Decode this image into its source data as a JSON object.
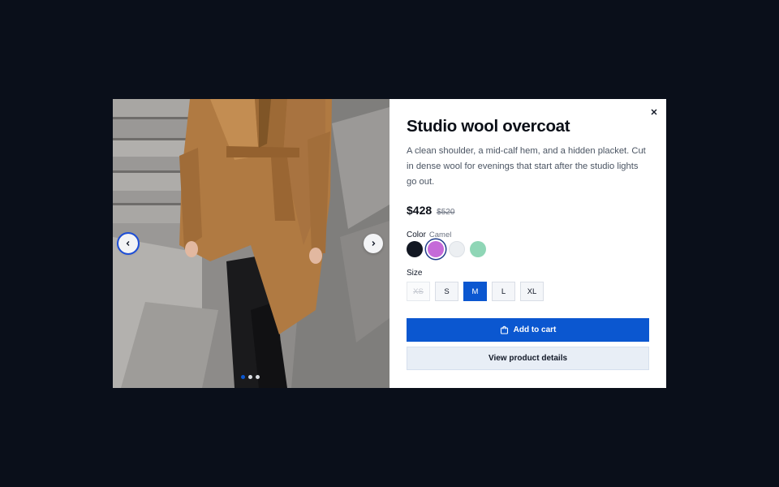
{
  "product": {
    "title": "Studio wool overcoat",
    "description": "A clean shoulder, a mid-calf hem, and a hidden placket. Cut in dense wool for evenings that start after the studio lights go out.",
    "price": "$428",
    "original_price": "$520"
  },
  "gallery": {
    "image_subject": "woman in camel belted wool overcoat on stone steps",
    "prev_icon": "chevron-left-icon",
    "next_icon": "chevron-right-icon",
    "slide_count": 3,
    "active_slide": 1
  },
  "color": {
    "label": "Color",
    "selected_name": "Camel",
    "swatches": [
      {
        "hex": "#121722",
        "selected": false
      },
      {
        "hex": "#c56ad8",
        "selected": true
      },
      {
        "hex": "#eceff2",
        "selected": false
      },
      {
        "hex": "#8fd6b6",
        "selected": false
      }
    ]
  },
  "size": {
    "label": "Size",
    "options": [
      {
        "label": "XS",
        "state": "disabled"
      },
      {
        "label": "S",
        "state": "available"
      },
      {
        "label": "M",
        "state": "selected"
      },
      {
        "label": "L",
        "state": "available"
      },
      {
        "label": "XL",
        "state": "available"
      }
    ]
  },
  "actions": {
    "add_to_cart": "Add to cart",
    "add_to_cart_icon": "shopping-bag-icon",
    "view_details": "View product details",
    "close_icon": "close-icon"
  },
  "colors": {
    "accent": "#0b57d0",
    "backdrop": "#0a0f1a"
  }
}
